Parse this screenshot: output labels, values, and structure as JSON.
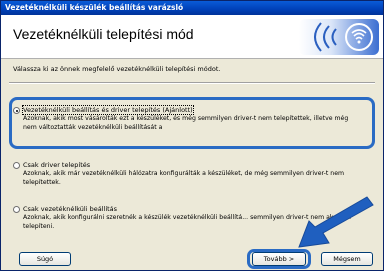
{
  "window": {
    "title": "Vezetéknélküli készülék beállítás varázsló"
  },
  "header": {
    "title": "Vezetéknélküli telepítési mód"
  },
  "instruction": "Válassza ki az önnek megfelelő vezetéknélküli telepítési módot.",
  "options": [
    {
      "label": "Vezetéknélküli beállítás és driver telepítés (Ajánlott)",
      "selected": true,
      "description": "Azoknak, akik most vásárolták ezt a készüléket, és még semmilyen driver-t nem telepítettek, illetve még nem változtatták vezetéknélküli beállítását a"
    },
    {
      "label": "Csak driver telepítés",
      "selected": false,
      "description": "Azoknak, akik már vezetéknélküli hálózatra konfigurálták a készüléket, de még semmilyen driver-t nem telepítettek."
    },
    {
      "label": "Csak vezetéknélküli beállítás",
      "selected": false,
      "description": "Azoknak, akik konfigurálni szeretnék a készülék vezetéknélküli beállítá... semmilyen driver-t nem akarnak telepíteni."
    }
  ],
  "buttons": {
    "help": "Súgó",
    "next": "Tovább >",
    "cancel": "Mégsem"
  },
  "colors": {
    "highlight": "#2a6bc4",
    "titlebar": "#0040b8"
  }
}
